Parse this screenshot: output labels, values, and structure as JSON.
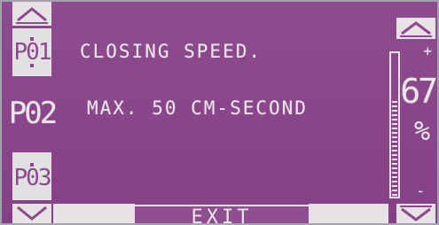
{
  "programs": {
    "items": [
      {
        "label": "P01",
        "selected": true
      },
      {
        "label": "P02",
        "selected": false
      },
      {
        "label": "P03",
        "selected": true
      }
    ]
  },
  "message": {
    "line1": "CLOSING SPEED.",
    "line2": "MAX. 50 CM-SECOND"
  },
  "level": {
    "value": "67",
    "unit": "%",
    "plus": "+",
    "minus": "-",
    "fraction": 0.67
  },
  "exit_label": "EXIT",
  "icons": {
    "up": "chevron-up-icon",
    "down": "chevron-down-icon"
  },
  "colors": {
    "screen": "#8a468a",
    "segment": "#ebe6ea"
  }
}
